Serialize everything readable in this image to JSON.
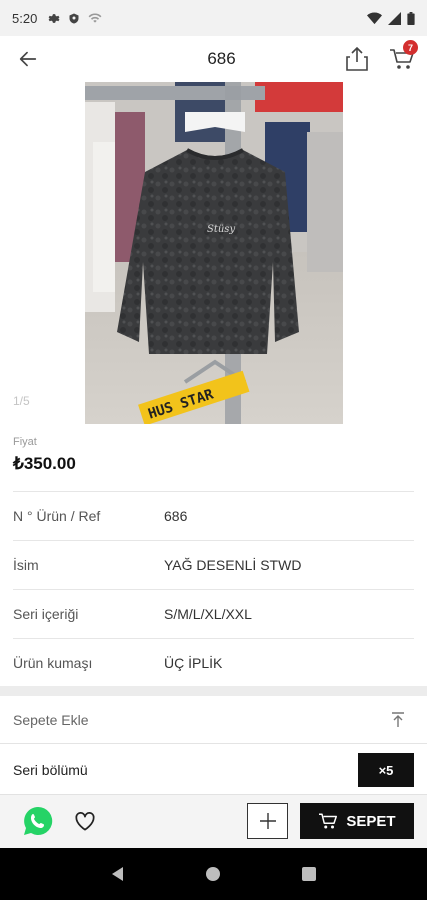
{
  "status_bar": {
    "time": "5:20"
  },
  "header": {
    "title": "686",
    "cart_count": "7"
  },
  "gallery": {
    "counter": "1/5",
    "label_text": "HUS STAR"
  },
  "price": {
    "label": "Fiyat",
    "value": "₺350.00"
  },
  "specs": [
    {
      "label": "N ° Ürün / Ref",
      "value": "686"
    },
    {
      "label": "İsim",
      "value": "YAĞ DESENLİ STWD"
    },
    {
      "label": "Seri içeriği",
      "value": "S/M/L/XL/XXL"
    },
    {
      "label": "Ürün kumaşı",
      "value": "ÜÇ İPLİK"
    }
  ],
  "add_to_cart": {
    "label": "Sepete Ekle"
  },
  "series": {
    "label": "Seri bölümü",
    "quantity": "×5"
  },
  "bottom_bar": {
    "cart_button_label": "SEPET"
  },
  "colors": {
    "accent": "#111111",
    "badge": "#d32f2f",
    "whatsapp": "#25d366"
  }
}
